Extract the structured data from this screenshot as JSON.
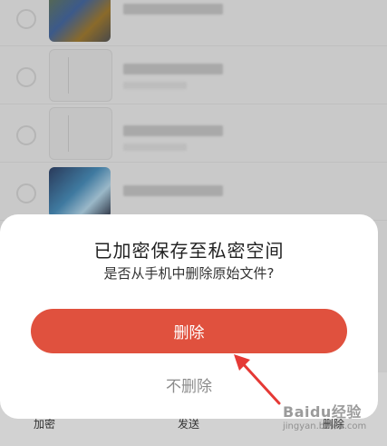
{
  "dialog": {
    "title": "已加密保存至私密空间",
    "message": "是否从手机中删除原始文件?",
    "primary_label": "删除",
    "secondary_label": "不删除"
  },
  "bottom_bar": {
    "items": [
      {
        "label": "加密"
      },
      {
        "label": "发送"
      },
      {
        "label": "删除"
      }
    ]
  },
  "watermark": {
    "brand": "Baidu经验",
    "url": "jingyan.baidu.com"
  },
  "colors": {
    "accent": "#e0513e",
    "annotation_arrow": "#e53935"
  }
}
